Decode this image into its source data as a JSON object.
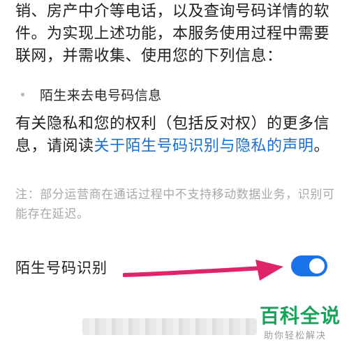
{
  "intro_text": "销、房产中介等电话，以及查询号码详情的软件。为实现上述功能，本服务使用过程中需要联网，并需收集、使用您的下列信息：",
  "bullet_items": [
    "陌生来去电号码信息"
  ],
  "rights": {
    "prefix": "有关隐私和您的权利（包括反对权）的更多信息，请阅读",
    "link": "关于陌生号码识别与隐私的声明",
    "suffix": "。"
  },
  "note": "注：部分运营商在通话过程中不支持移动数据业务，识别可能存在延迟。",
  "setting": {
    "label": "陌生号码识别",
    "enabled": true
  },
  "watermark": {
    "title": "百科全说",
    "subtitle": "助你轻松解决"
  },
  "colors": {
    "link": "#1a6fd1",
    "toggle_on": "#1a73e8",
    "arrow": "#e0246a",
    "watermark": "#1aa35a"
  }
}
